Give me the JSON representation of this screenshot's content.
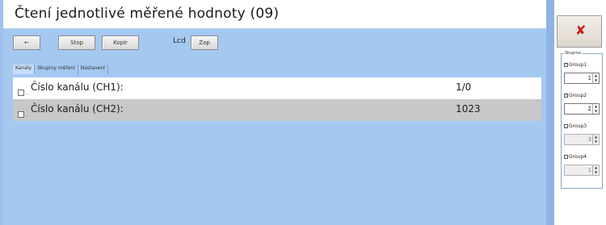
{
  "window": {
    "title": "Čtení jednotlivé měřené hodnoty (09)"
  },
  "toolbar": {
    "buttons": [
      "←",
      "Stop",
      "Kopír"
    ],
    "lcd_label": "Lcd",
    "lcd_button": "Zap"
  },
  "tabs": [
    {
      "label": "Kanály",
      "active": true
    },
    {
      "label": "Skupiny měření",
      "active": false
    },
    {
      "label": "Nastavení",
      "active": false
    }
  ],
  "measurements": [
    {
      "label": "Číslo kanálu (CH1):",
      "value": "1/0"
    },
    {
      "label": "Číslo kanálu (CH2):",
      "value": "1023"
    }
  ],
  "side_panel": {
    "close_icon": "close-icon",
    "group_label": "Skupina",
    "options": [
      {
        "label": "Group1",
        "checked": true,
        "spin_value": "1",
        "enabled": true
      },
      {
        "label": "Group2",
        "checked": true,
        "spin_value": "2",
        "enabled": true
      },
      {
        "label": "Group3",
        "checked": false,
        "spin_value": "3",
        "enabled": false
      },
      {
        "label": "Group4",
        "checked": false,
        "spin_value": "1",
        "enabled": false
      }
    ]
  }
}
